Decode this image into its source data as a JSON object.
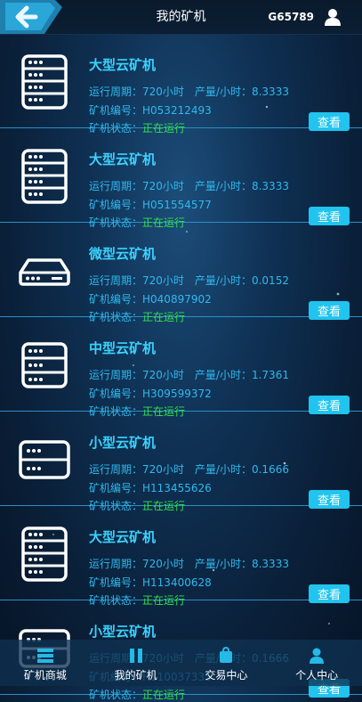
{
  "header": {
    "title": "我的矿机",
    "user_id": "G65789"
  },
  "miners": [
    {
      "name": "大型云矿机",
      "icon": "server-rack-icon",
      "cycle_label": "运行周期：",
      "cycle": "720小时",
      "output_label": "产量/小时：",
      "output": "8.3333",
      "id_label": "矿机编号：",
      "id": "H053212493",
      "status_label": "矿机状态：",
      "status": "正在运行",
      "button": "查看"
    },
    {
      "name": "大型云矿机",
      "icon": "server-rack-icon",
      "cycle_label": "运行周期：",
      "cycle": "720小时",
      "output_label": "产量/小时：",
      "output": "8.3333",
      "id_label": "矿机编号：",
      "id": "H051554577",
      "status_label": "矿机状态：",
      "status": "正在运行",
      "button": "查看"
    },
    {
      "name": "微型云矿机",
      "icon": "mini-device-icon",
      "cycle_label": "运行周期：",
      "cycle": "720小时",
      "output_label": "产量/小时：",
      "output": "0.0152",
      "id_label": "矿机编号：",
      "id": "H040897902",
      "status_label": "矿机状态：",
      "status": "正在运行",
      "button": "查看"
    },
    {
      "name": "中型云矿机",
      "icon": "server-medium-icon",
      "cycle_label": "运行周期：",
      "cycle": "720小时",
      "output_label": "产量/小时：",
      "output": "1.7361",
      "id_label": "矿机编号：",
      "id": "H309599372",
      "status_label": "矿机状态：",
      "status": "正在运行",
      "button": "查看"
    },
    {
      "name": "小型云矿机",
      "icon": "server-small-icon",
      "cycle_label": "运行周期：",
      "cycle": "720小时",
      "output_label": "产量/小时：",
      "output": "0.1666",
      "id_label": "矿机编号：",
      "id": "H113455626",
      "status_label": "矿机状态：",
      "status": "正在运行",
      "button": "查看"
    },
    {
      "name": "大型云矿机",
      "icon": "server-rack-icon",
      "cycle_label": "运行周期：",
      "cycle": "720小时",
      "output_label": "产量/小时：",
      "output": "8.3333",
      "id_label": "矿机编号：",
      "id": "H113400628",
      "status_label": "矿机状态：",
      "status": "正在运行",
      "button": "查看"
    },
    {
      "name": "小型云矿机",
      "icon": "server-small-icon",
      "cycle_label": "运行周期：",
      "cycle": "720小时",
      "output_label": "产量/小时：",
      "output": "0.1666",
      "id_label": "矿机编号：",
      "id": "H110037335",
      "status_label": "矿机状态：",
      "status": "正在运行",
      "button": "查看"
    }
  ],
  "tabs": [
    {
      "label": "矿机商城",
      "icon": "store-icon"
    },
    {
      "label": "我的矿机",
      "icon": "my-miner-icon"
    },
    {
      "label": "交易中心",
      "icon": "trade-bag-icon"
    },
    {
      "label": "个人中心",
      "icon": "person-icon"
    }
  ],
  "colors": {
    "accent": "#20c4ee",
    "title": "#3ad3ff",
    "info": "#2fb9ec",
    "status": "#2fe34a"
  }
}
